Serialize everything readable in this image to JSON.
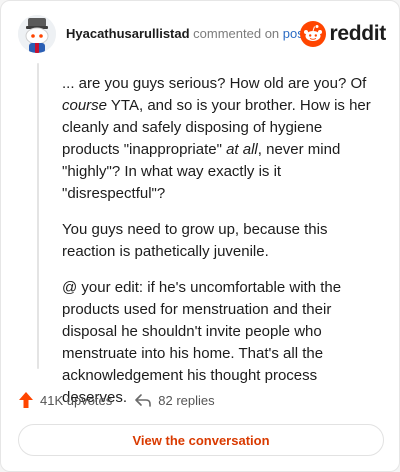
{
  "header": {
    "username": "Hyacathusarullistad",
    "action_text": "commented on",
    "link_text": "post",
    "brand": "reddit"
  },
  "comment": {
    "p1_a": "... are you guys serious? How old are you? Of ",
    "p1_b": "course",
    "p1_c": " YTA, and so is your brother. How is her cleanly and safely disposing of hygiene products \"inappropriate\" ",
    "p1_d": "at all",
    "p1_e": ", never mind \"highly\"? In what way exactly is it \"disrespectful\"?",
    "p2": "You guys need to grow up, because this reaction is pathetically juvenile.",
    "p3": "@ your edit: if he's uncomfortable with the products used for menstruation and their disposal he shouldn't invite people who menstruate into his home. That's all the acknowledgement his thought process deserves."
  },
  "actions": {
    "upvotes": "41K upvotes",
    "replies": "82 replies"
  },
  "view_button": "View the conversation",
  "colors": {
    "accent": "#ff4500",
    "link": "#2b6cc4",
    "button_text": "#d93a00"
  },
  "icons": {
    "avatar": "snoo-avatar-icon",
    "logo": "reddit-logo-icon",
    "upvote": "upvote-arrow-icon",
    "reply": "reply-arrow-icon"
  }
}
